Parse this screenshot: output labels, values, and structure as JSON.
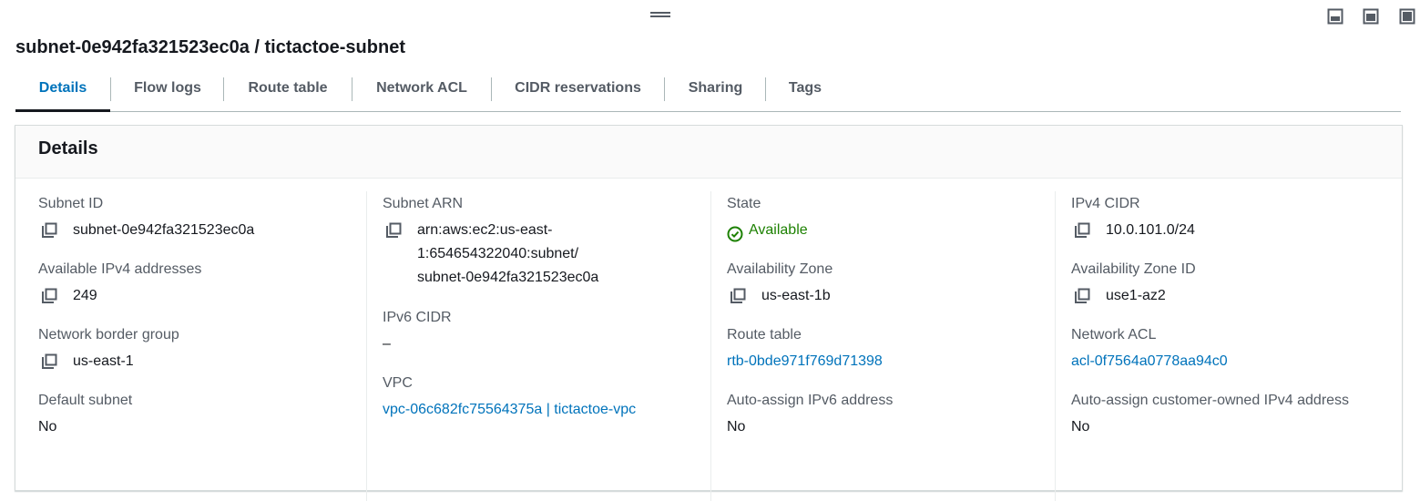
{
  "panel_controls": [
    "panel-bottom-icon",
    "panel-middle-icon",
    "panel-full-icon"
  ],
  "title": "subnet-0e942fa321523ec0a / tictactoe-subnet",
  "tabs": [
    {
      "label": "Details"
    },
    {
      "label": "Flow logs"
    },
    {
      "label": "Route table"
    },
    {
      "label": "Network ACL"
    },
    {
      "label": "CIDR reservations"
    },
    {
      "label": "Sharing"
    },
    {
      "label": "Tags"
    }
  ],
  "active_tab": "Details",
  "details": {
    "heading": "Details",
    "subnet_id": {
      "label": "Subnet ID",
      "value": "subnet-0e942fa321523ec0a"
    },
    "available_ipv4": {
      "label": "Available IPv4 addresses",
      "value": "249"
    },
    "network_border_group": {
      "label": "Network border group",
      "value": "us-east-1"
    },
    "default_subnet": {
      "label": "Default subnet",
      "value": "No"
    },
    "subnet_arn": {
      "label": "Subnet ARN",
      "value": "arn:aws:ec2:us-east-1:654654322040:subnet/subnet-0e942fa321523ec0a"
    },
    "ipv6_cidr": {
      "label": "IPv6 CIDR",
      "value": "–"
    },
    "vpc": {
      "label": "VPC",
      "value": "vpc-06c682fc75564375a | tictactoe-vpc"
    },
    "state": {
      "label": "State",
      "value": "Available"
    },
    "availability_zone": {
      "label": "Availability Zone",
      "value": "us-east-1b"
    },
    "route_table": {
      "label": "Route table",
      "value": "rtb-0bde971f769d71398"
    },
    "auto_assign_ipv6": {
      "label": "Auto-assign IPv6 address",
      "value": "No"
    },
    "ipv4_cidr": {
      "label": "IPv4 CIDR",
      "value": "10.0.101.0/24"
    },
    "availability_zone_id": {
      "label": "Availability Zone ID",
      "value": "use1-az2"
    },
    "network_acl": {
      "label": "Network ACL",
      "value": "acl-0f7564a0778aa94c0"
    },
    "auto_assign_customer_ipv4": {
      "label": "Auto-assign customer-owned IPv4 address",
      "value": "No"
    }
  },
  "colors": {
    "link": "#0073bb",
    "success": "#1d8102",
    "text": "#16191f",
    "label": "#545b64"
  }
}
